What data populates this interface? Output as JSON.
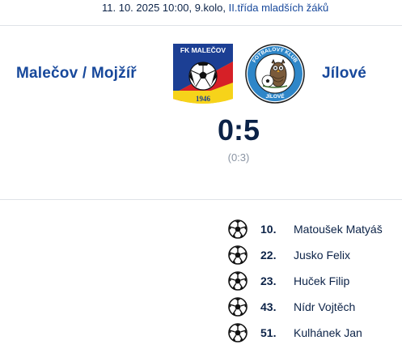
{
  "match": {
    "date_time": "11. 10. 2025 10:00, 9.kolo,",
    "competition": "II.třída mladších žáků",
    "home_team": "Malečov / Mojžíř",
    "away_team": "Jílové",
    "score": "0:5",
    "halftime": "(0:3)"
  },
  "crests": {
    "home": {
      "top_text": "FK MALEČOV",
      "year": "1946",
      "colors": {
        "blue": "#1c3f94",
        "yellow": "#f6d31a",
        "red": "#d62027"
      }
    },
    "away": {
      "ring_text": "FOTBALOVÝ KLUB",
      "bottom_text": "JÍLOVÉ",
      "colors": {
        "blue": "#2e86c8",
        "dark": "#1a1a1a"
      }
    }
  },
  "scorers": [
    {
      "minute": "10.",
      "name": "Matoušek Matyáš"
    },
    {
      "minute": "22.",
      "name": "Jusko Felix"
    },
    {
      "minute": "23.",
      "name": "Huček Filip"
    },
    {
      "minute": "43.",
      "name": "Nídr Vojtěch"
    },
    {
      "minute": "51.",
      "name": "Kulhánek Jan"
    }
  ],
  "icons": {
    "goal": "football-icon"
  },
  "colors": {
    "navy": "#0b2247",
    "link_blue": "#17489b",
    "muted": "#8a94a3"
  }
}
